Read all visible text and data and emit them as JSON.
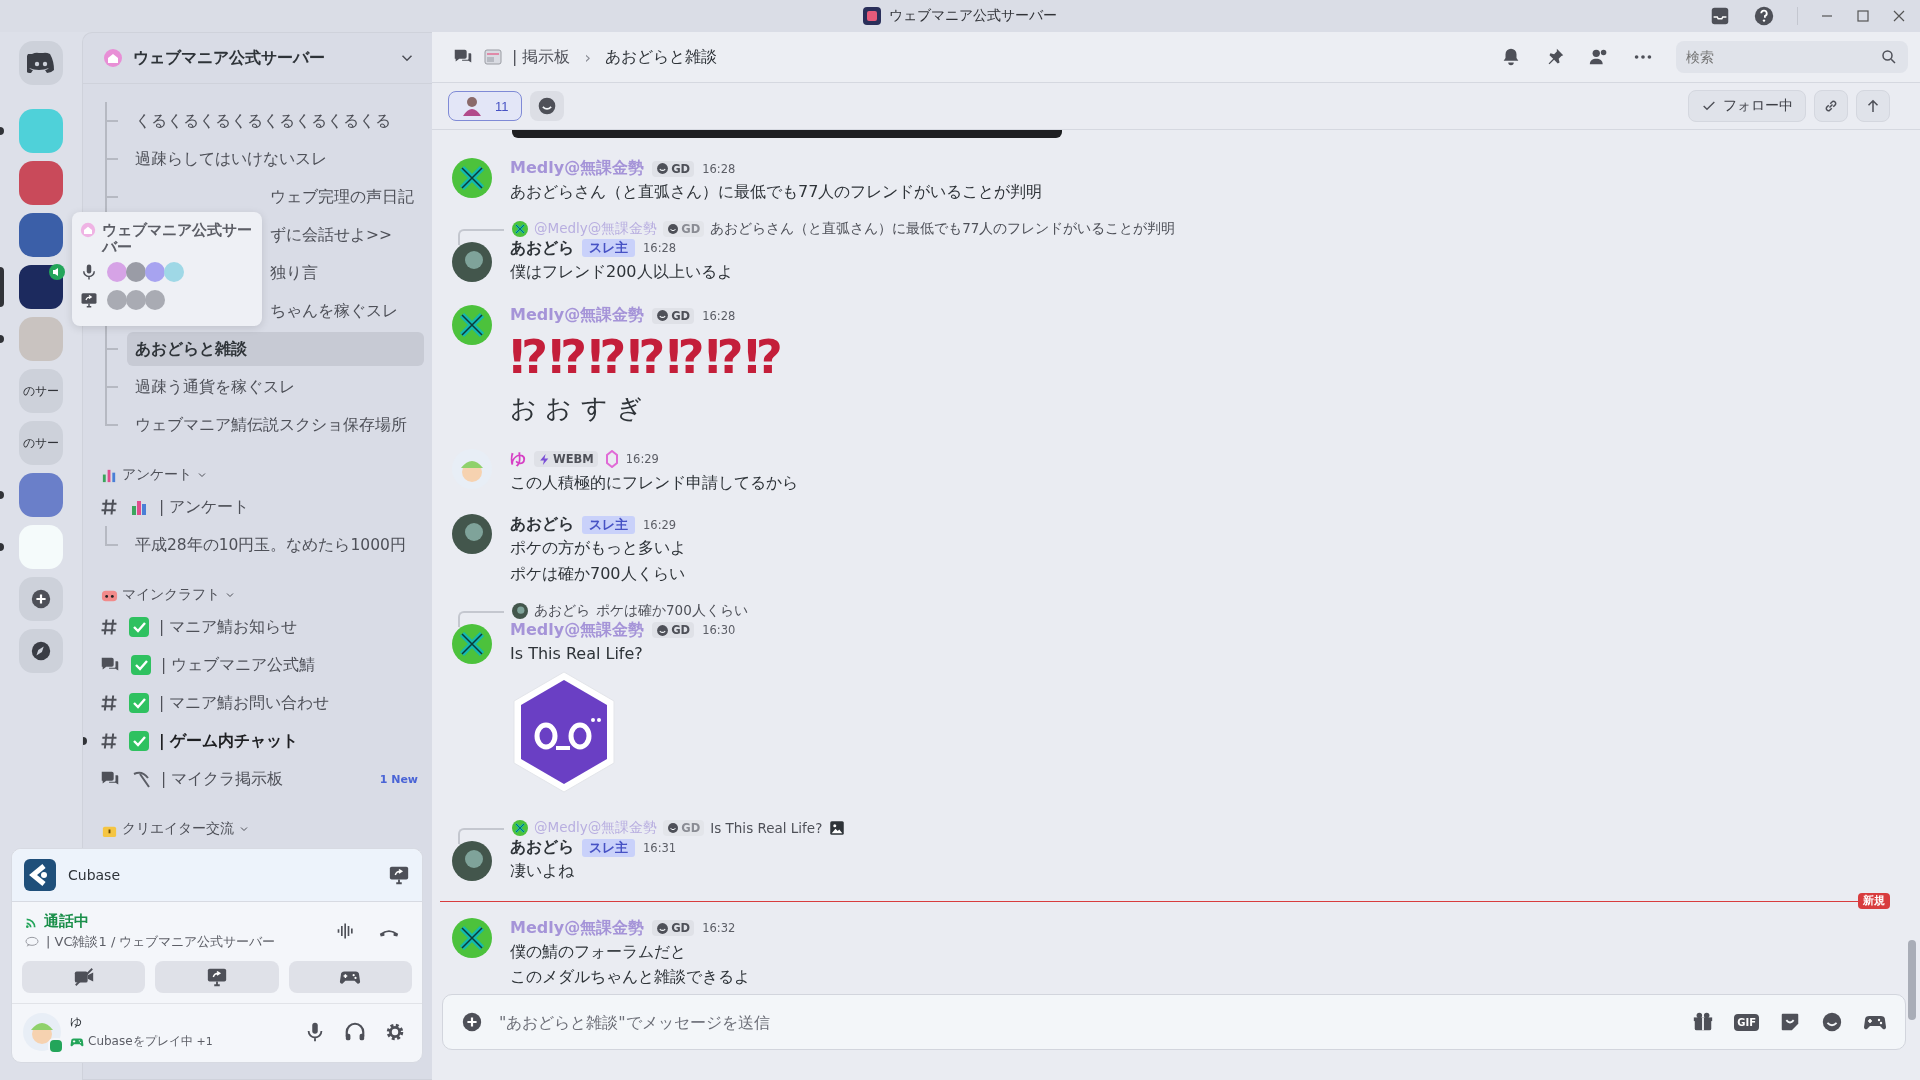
{
  "window": {
    "title": "ウェブマニア公式サーバー"
  },
  "servers": [
    {
      "kind": "image",
      "color": "#4fd1d9",
      "unread": true,
      "selected": false,
      "speaking": false
    },
    {
      "kind": "image",
      "color": "#c94a5a",
      "unread": false,
      "selected": false,
      "speaking": false
    },
    {
      "kind": "image",
      "color": "#3b5fa8",
      "unread": false,
      "selected": false,
      "speaking": false
    },
    {
      "kind": "image",
      "color": "#1c2a5e",
      "unread": false,
      "selected": true,
      "speaking": true
    },
    {
      "kind": "image",
      "color": "#c9c3c0",
      "unread": true,
      "selected": false,
      "speaking": false
    },
    {
      "kind": "text",
      "label": "のサー",
      "unread": false,
      "selected": false,
      "speaking": false
    },
    {
      "kind": "text",
      "label": "のサー",
      "unread": false,
      "selected": false,
      "speaking": false
    },
    {
      "kind": "image",
      "color": "#6a7fc9",
      "unread": true,
      "selected": false,
      "speaking": false
    },
    {
      "kind": "image",
      "color": "#f5fbfb",
      "unread": true,
      "selected": false,
      "speaking": false
    }
  ],
  "sidebar": {
    "server_name": "ウェブマニア公式サーバー",
    "threads": [
      {
        "name": "くるくるくるくるくるくるくるくる",
        "selected": false
      },
      {
        "name": "過疎らしてはいけないスレ",
        "selected": false
      },
      {
        "name": "ウェブ完理の声日記",
        "selected": false
      },
      {
        "name": "ずに会話せよ>>",
        "selected": false
      },
      {
        "name": "独り言",
        "selected": false
      },
      {
        "name": "ちゃんを稼ぐスレ",
        "selected": false
      },
      {
        "name": "あおどらと雑談",
        "selected": true
      },
      {
        "name": "過疎う通貨を稼ぐスレ",
        "selected": false
      },
      {
        "name": "ウェブマニア鯖伝説スクショ保存場所",
        "selected": false
      }
    ],
    "categories": [
      {
        "name": "アンケート",
        "channels": [
          {
            "kind": "text",
            "name": "| アンケート",
            "unread": false,
            "threads": [
              {
                "name": "平成28年の10円玉。なめたら1000円"
              }
            ]
          }
        ]
      },
      {
        "name": "マインクラフト",
        "channels": [
          {
            "kind": "text",
            "name": "| マニア鯖お知らせ",
            "unread": false
          },
          {
            "kind": "forum",
            "name": "| ウェブマニア公式鯖",
            "unread": false
          },
          {
            "kind": "text",
            "name": "| マニア鯖お問い合わせ",
            "unread": false
          },
          {
            "kind": "text",
            "name": "| ゲーム内チャット",
            "unread": true
          },
          {
            "kind": "forum",
            "name": "| マイクラ掲示板",
            "unread": false,
            "badge": "1 New"
          }
        ]
      },
      {
        "name": "クリエイター交流"
      }
    ]
  },
  "tooltip": {
    "title": "ウェブマニア公式サーバー"
  },
  "voice_panel": {
    "activity": "Cubase",
    "status": "通話中",
    "channel": "| VC雑談1 / ウェブマニア公式サーバー"
  },
  "user": {
    "name": "ゆ",
    "activity": "Cubaseをプレイ中",
    "extra": "+1"
  },
  "header": {
    "parent": "| 掲示板",
    "separator": "›",
    "thread": "あおどらと雑談",
    "search": {
      "placeholder": "検索"
    }
  },
  "subbar": {
    "member_count": "11",
    "follow": "フォロー中"
  },
  "messages": [
    {
      "kind": "tools",
      "author": "Medly@無課金勢",
      "color": "#a594d8",
      "tag": {
        "kind": "guild",
        "label": "GD"
      },
      "time": "16:28",
      "blocks": [
        {
          "kind": "text",
          "text": "あおどらさん（と直弧さん）に最低でも77人のフレンドがいることが判明"
        }
      ]
    },
    {
      "kind": "photo",
      "reply": {
        "kind": "tools",
        "author": "@Medly@無課金勢",
        "tag": "GD",
        "text": "あおどらさん（と直弧さん）に最低でも77人のフレンドがいることが判明",
        "image": false
      },
      "author": "あおどら",
      "color": "#2e3338",
      "tag": {
        "kind": "role",
        "label": "スレ主"
      },
      "time": "16:28",
      "blocks": [
        {
          "kind": "text",
          "text": "僕はフレンド200人以上いるよ"
        }
      ]
    },
    {
      "kind": "tools",
      "author": "Medly@無課金勢",
      "color": "#a594d8",
      "tag": {
        "kind": "guild",
        "label": "GD"
      },
      "time": "16:28",
      "blocks": [
        {
          "kind": "jumbo",
          "text": "⁉⁉⁉⁉⁉⁉⁉"
        },
        {
          "kind": "big",
          "text": "お お す ぎ"
        }
      ]
    },
    {
      "kind": "cartoon",
      "author": "ゆ",
      "color": "#d63fc4",
      "tag": {
        "kind": "clan",
        "label": "WEBM"
      },
      "boosting": true,
      "time": "16:29",
      "blocks": [
        {
          "kind": "text",
          "text": "この人積極的にフレンド申請してるから"
        }
      ]
    },
    {
      "kind": "photo",
      "author": "あおどら",
      "color": "#2e3338",
      "tag": {
        "kind": "role",
        "label": "スレ主"
      },
      "time": "16:29",
      "blocks": [
        {
          "kind": "text",
          "text": "ポケの方がもっと多いよ"
        },
        {
          "kind": "text",
          "text": "ポケは確か700人くらい"
        }
      ]
    },
    {
      "kind": "tools",
      "reply": {
        "kind": "photo",
        "author": "あおどら",
        "text": "ポケは確か700人くらい",
        "image": false
      },
      "author": "Medly@無課金勢",
      "color": "#a594d8",
      "tag": {
        "kind": "guild",
        "label": "GD"
      },
      "time": "16:30",
      "blocks": [
        {
          "kind": "text",
          "text": "Is This Real Life?"
        },
        {
          "kind": "sticker"
        }
      ]
    },
    {
      "kind": "photo",
      "reply": {
        "kind": "tools",
        "author": "@Medly@無課金勢",
        "tag": "GD",
        "text": "Is This Real Life?",
        "image": true
      },
      "author": "あおどら",
      "color": "#2e3338",
      "tag": {
        "kind": "role",
        "label": "スレ主"
      },
      "time": "16:31",
      "blocks": [
        {
          "kind": "text",
          "text": "凄いよね"
        }
      ]
    },
    {
      "kind": "tools",
      "new_marker": "新規",
      "author": "Medly@無課金勢",
      "color": "#a594d8",
      "tag": {
        "kind": "guild",
        "label": "GD"
      },
      "time": "16:32",
      "blocks": [
        {
          "kind": "text",
          "text": "僕の鯖のフォーラムだと"
        },
        {
          "kind": "text",
          "text": "このメダルちゃんと雑談できるよ"
        }
      ]
    }
  ],
  "composer": {
    "placeholder": "\"あおどらと雑談\"でメッセージを送信",
    "gif": "GIF"
  }
}
